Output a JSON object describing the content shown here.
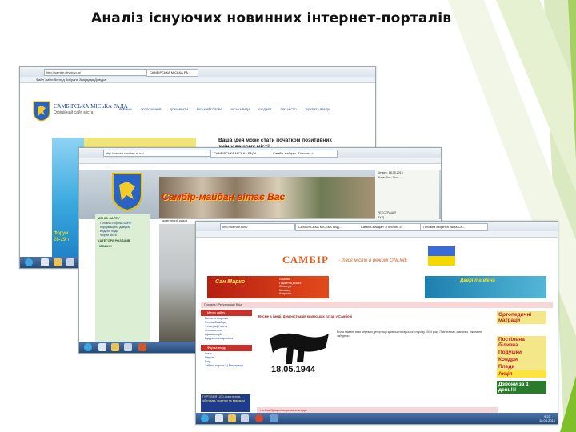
{
  "slide": {
    "title": "Аналіз існуючих новинних інтернет-порталів"
  },
  "colors": {
    "accent_green": "#7fbf2a",
    "deco_light": "#c9e39a",
    "portal_red": "#c8302c",
    "title": "#111111"
  },
  "screenshot1": {
    "address": "http://sambir-city.gov.ua/",
    "tab": "САМБІРСЬКА МІСЬКА РА...",
    "menu": "Файл   Зміни   Вигляд   Вибране   Знаряддя   Довідка",
    "brand": "САМБІРСЬКА МІСЬКА РАДА",
    "brand_subtitle": "Офіційний сайт міста",
    "nav": [
      "НОВИНИ",
      "ОГОЛОШЕННЯ",
      "ДОКУМЕНТИ",
      "МІСЬКИЙ ГОЛОВА",
      "МІСЬКА РАДА",
      "БЮДЖЕТ",
      "ПРО МІСТО",
      "ВІДКРИТА ВЛАДА"
    ],
    "headline": "Ваша ідея може стати початком позитивних",
    "headline2": "змін у вашому місті!",
    "forum_line1": "Форум",
    "forum_line2": "28-29 т"
  },
  "screenshot2": {
    "address": "http://sambir-maidan.at.ua/",
    "tab": "Самбір-майдан - Головна с...",
    "tab_prev": "САМБІРСЬКА МІСЬКА РАДА",
    "header_title": "Самбір-майдан вітає Вас",
    "left_menu_heading": "МЕНЮ САЙТУ",
    "left_menu": [
      "Головна сторінка сайту",
      "Інформаційна довідка",
      "Видатні люди",
      "Форум міста"
    ],
    "categories_heading": "КАТЕГОРІЇ РОЗДІЛІВ",
    "news_heading": "НОВИНИ",
    "news_label": "жовтневий кидок",
    "right_text": [
      "Четвер, 18.05.2016",
      "Вітаю Вас, Гість",
      "РЕЄСТРАЦІЯ",
      "ВХІД"
    ]
  },
  "screenshot3": {
    "address": "http://sambir.com/",
    "tabs": [
      "САМБІРСЬКА МІСЬКА РАД...",
      "Самбір-майдан - Головна с...",
      "Головна сторінка міста Са..."
    ],
    "logo": "САМБІР",
    "slogan": "- твоє місто в режимі ONLINE",
    "ad1_brand": "Сан Марко",
    "ad1_lines": [
      "Ламінат",
      "Паркетна дошка",
      "Лінолеум",
      "Килими",
      "Ковролін"
    ],
    "ad2_text": "Двері та вікна",
    "pinkbar": "Головна | Реєстрація | Вхід",
    "menu_heading": "Меню сайту",
    "menu_items": [
      "Головна сторінка",
      "Історія Самбора",
      "Фотографії міста",
      "Оголошення",
      "Афіша подій",
      "Відкрита влада міста"
    ],
    "login_heading": "Форма входу",
    "login_labels": [
      "Логін:",
      "Пароль:",
      "Вхід",
      "Забули пароль? | Реєстрація"
    ],
    "article_title": "Вусме в імеді. Демонстрація кримських татар у Самборі",
    "memo_date": "18.05.1944",
    "article_text": "Вічна пам'ять всім жертвам депортації кримськотатарського народу 1944 року. Пам'ятаємо, шануємо, ніколи не забудемо.",
    "right_ads": [
      "Ортопедичні матраци",
      "Постільна білизна",
      "Подушки",
      "Ковдри",
      "Пледи",
      "Акція"
    ],
    "right_ad_bottom": "Дзвони за 1 день!!!",
    "gurt_text": "ГУРТІВНЯ LED-освітлення, обігрівачі, розетки та вимикачі",
    "news_bar": "На Самбірщині затримали злодія",
    "clock_time": "9:22",
    "clock_date": "18.05.2016"
  }
}
